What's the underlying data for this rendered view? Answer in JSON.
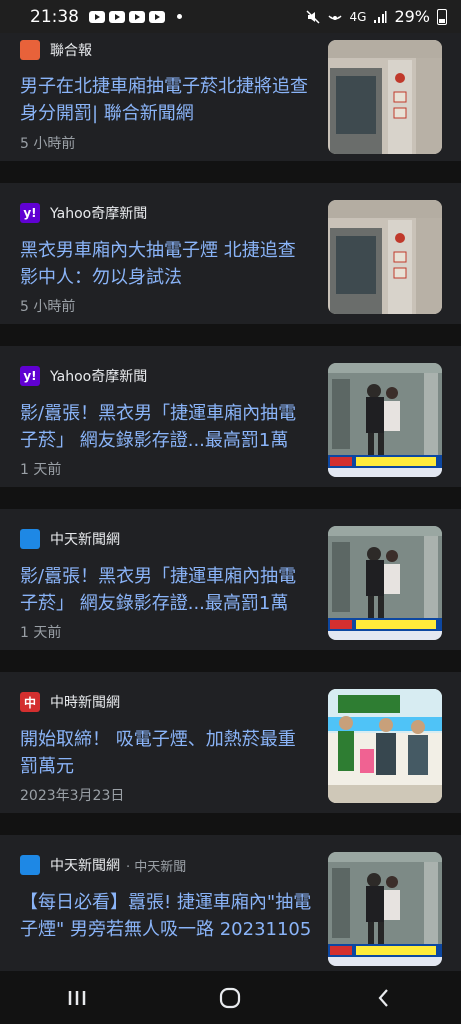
{
  "status": {
    "time": "21:38",
    "battery": "29%",
    "network": "4G"
  },
  "articles": [
    {
      "source": "聯合報",
      "source_extra": "",
      "title": "男子在北捷車廂抽電子菸北捷將追查身分開罰| 聯合新聞網",
      "time": "5 小時前",
      "logo_color": "#e8623a",
      "logo_text": "",
      "thumb": "train-interior-icon"
    },
    {
      "source": "Yahoo奇摩新聞",
      "source_extra": "",
      "title": "黑衣男車廂內大抽電子煙 北捷追查影中人：勿以身試法",
      "time": "5 小時前",
      "logo_color": "#6001d2",
      "logo_text": "y!",
      "thumb": "train-interior-icon"
    },
    {
      "source": "Yahoo奇摩新聞",
      "source_extra": "",
      "title": "影/囂張！黑衣男「捷運車廂內抽電子菸」 網友錄影存證...最高罰1萬",
      "time": "1 天前",
      "logo_color": "#6001d2",
      "logo_text": "y!",
      "thumb": "news-clip-icon"
    },
    {
      "source": "中天新聞網",
      "source_extra": "",
      "title": "影/囂張！黑衣男「捷運車廂內抽電子菸」 網友錄影存證...最高罰1萬",
      "time": "1 天前",
      "logo_color": "#1e88e5",
      "logo_text": "",
      "thumb": "news-clip-icon"
    },
    {
      "source": "中時新聞網",
      "source_extra": "",
      "title": "開始取締！ 吸電子煙、加熱菸最重罰萬元",
      "time": "2023年3月23日",
      "logo_color": "#d32f2f",
      "logo_text": "中",
      "thumb": "press-event-icon"
    },
    {
      "source": "中天新聞網",
      "source_extra": "· 中天新聞",
      "title": "【每日必看】囂張! 捷運車廂內\"抽電子煙\" 男旁若無人吸一路 20231105",
      "time": "",
      "logo_color": "#1e88e5",
      "logo_text": "",
      "thumb": "news-clip-icon"
    }
  ]
}
